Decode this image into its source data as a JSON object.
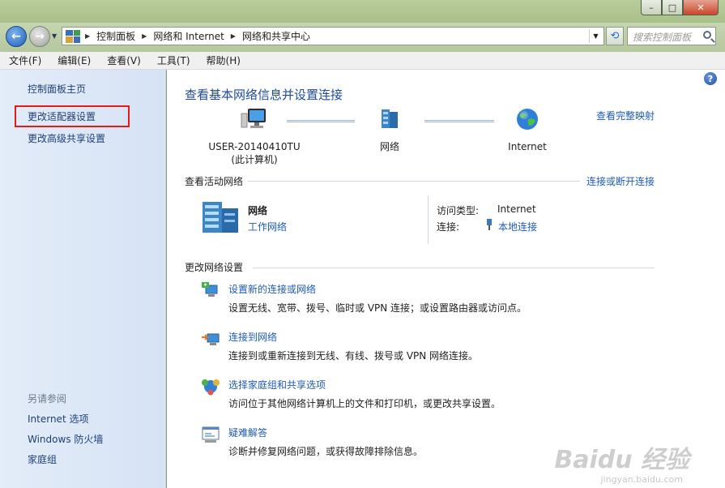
{
  "window": {
    "controls": [
      "–",
      "□",
      "✕"
    ]
  },
  "address": {
    "crumbs": [
      "控制面板",
      "网络和 Internet",
      "网络和共享中心"
    ],
    "search_placeholder": "搜索控制面板"
  },
  "menu": [
    "文件(F)",
    "编辑(E)",
    "查看(V)",
    "工具(T)",
    "帮助(H)"
  ],
  "sidebar": {
    "home": "控制面板主页",
    "adapter": "更改适配器设置",
    "sharing": "更改高级共享设置",
    "see_also_title": "另请参阅",
    "see_also": [
      "Internet 选项",
      "Windows 防火墙",
      "家庭组"
    ]
  },
  "main": {
    "title": "查看基本网络信息并设置连接",
    "map_link": "查看完整映射",
    "nodes": {
      "computer_line1": "USER-20140410TU",
      "computer_line2": "(此计算机)",
      "network": "网络",
      "internet": "Internet"
    },
    "active_section": "查看活动网络",
    "connect_link": "连接或断开连接",
    "network_name": "网络",
    "network_type": "工作网络",
    "access_type_label": "访问类型:",
    "access_type_value": "Internet",
    "connection_label": "连接:",
    "connection_value": "本地连接",
    "change_section": "更改网络设置",
    "tasks": [
      {
        "title": "设置新的连接或网络",
        "desc": "设置无线、宽带、拨号、临时或 VPN 连接；或设置路由器或访问点。",
        "icon": "new-connection-icon"
      },
      {
        "title": "连接到网络",
        "desc": "连接到或重新连接到无线、有线、拨号或 VPN 网络连接。",
        "icon": "connect-network-icon"
      },
      {
        "title": "选择家庭组和共享选项",
        "desc": "访问位于其他网络计算机上的文件和打印机，或更改共享设置。",
        "icon": "homegroup-icon"
      },
      {
        "title": "疑难解答",
        "desc": "诊断并修复网络问题，或获得故障排除信息。",
        "icon": "troubleshoot-icon"
      }
    ]
  },
  "watermark": {
    "logo": "Baidu 经验",
    "url": "jingyan.baidu.com"
  },
  "colors": {
    "link": "#1e5bb8",
    "highlight_box": "#e81919",
    "sidebar_bg": "#dbe6f6"
  }
}
